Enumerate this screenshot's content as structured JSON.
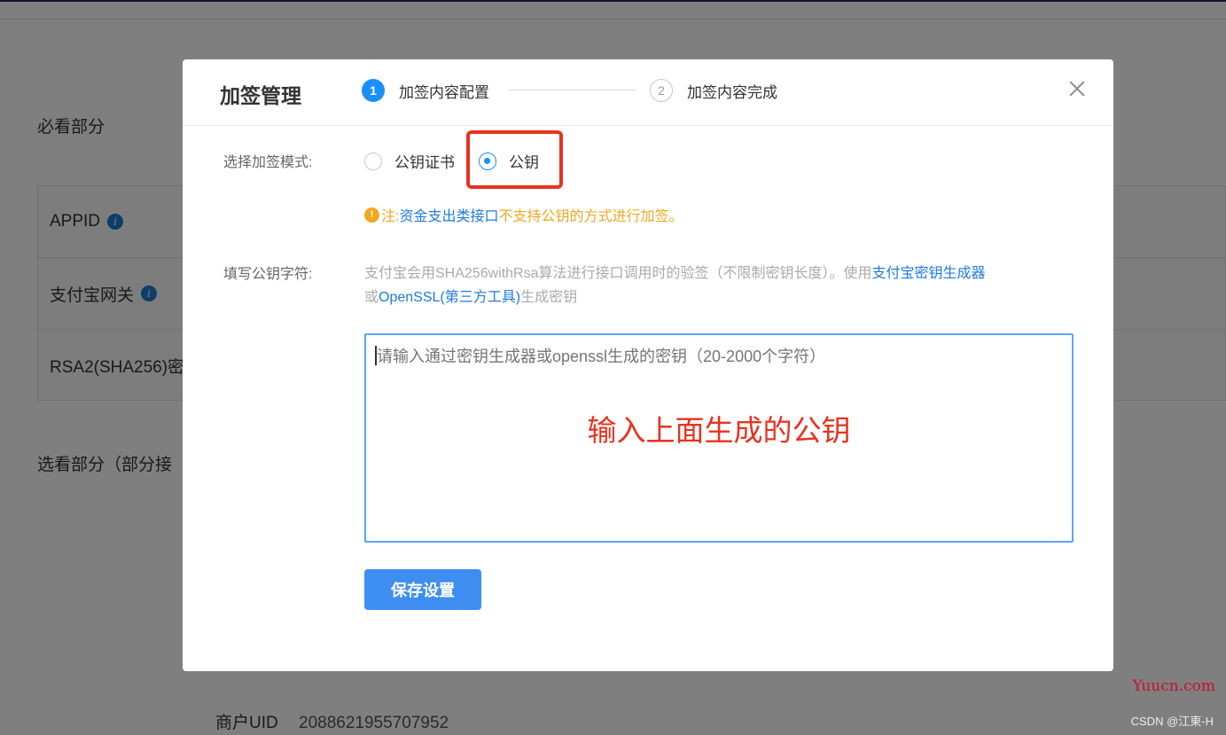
{
  "background": {
    "section_required": "必看部分",
    "section_optional": "选看部分（部分接",
    "rows": [
      {
        "label": "APPID",
        "has_info": true
      },
      {
        "label": "支付宝网关",
        "has_info": true
      },
      {
        "label": "RSA2(SHA256)密",
        "has_info": false
      }
    ],
    "merchant_uid_label": "商户UID",
    "merchant_uid_value": "2088621955707952"
  },
  "modal": {
    "title": "加签管理",
    "steps": [
      {
        "num": "1",
        "label": "加签内容配置",
        "active": true
      },
      {
        "num": "2",
        "label": "加签内容完成",
        "active": false
      }
    ],
    "mode_label": "选择加签模式:",
    "mode_options": [
      {
        "label": "公钥证书",
        "checked": false
      },
      {
        "label": "公钥",
        "checked": true
      }
    ],
    "note": {
      "icon": "!",
      "prefix": "注:",
      "blue_text": "资金支出类接口",
      "orange_text": "不支持公钥的方式进行加签。"
    },
    "key_label": "填写公钥字符:",
    "description": {
      "text1": "支付宝会用SHA256withRsa算法进行接口调用时的验签（不限制密钥长度）。使用",
      "link1": "支付宝密钥生成器",
      "text2": "或",
      "link2": "OpenSSL(第三方工具)",
      "text3": "生成密钥"
    },
    "textarea_placeholder": "请输入通过密钥生成器或openssl生成的密钥（20-2000个字符）",
    "annotation": "输入上面生成的公钥",
    "save_button": "保存设置"
  },
  "watermarks": {
    "site": "Yuucn.com",
    "csdn": "CSDN @江東-H"
  },
  "colors": {
    "primary": "#1890ff",
    "warning": "#f0a820",
    "highlight_red": "#e8321f",
    "link_blue": "#1f7ae0"
  }
}
